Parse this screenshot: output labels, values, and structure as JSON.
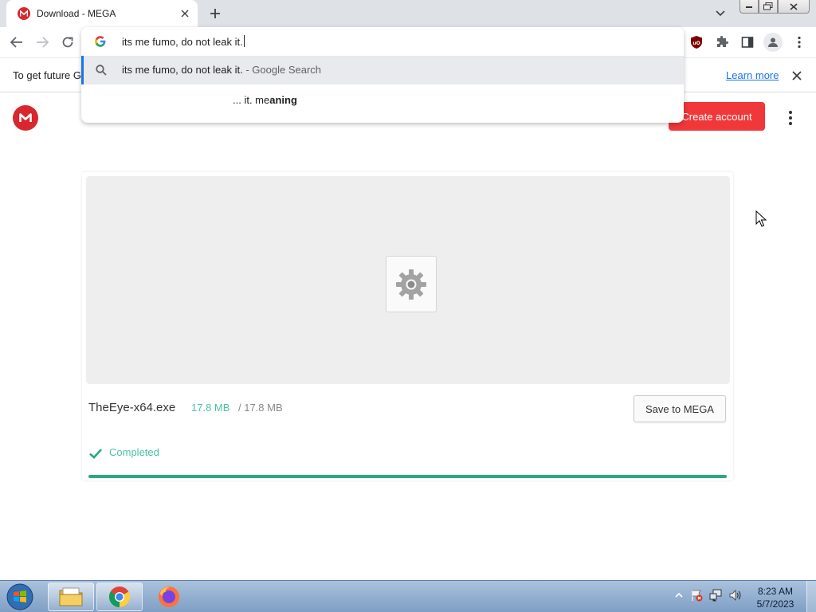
{
  "browser": {
    "tab": {
      "title": "Download - MEGA",
      "favicon": "mega-icon"
    },
    "omnibox": {
      "value": "its me fumo, do not leak it.",
      "suggestions": [
        {
          "query": "its me fumo, do not leak it.",
          "suffix": "- Google Search",
          "icon": "search-icon"
        },
        {
          "prefix": "... it. me",
          "bold": "aning"
        }
      ]
    },
    "infobar": {
      "text": "To get future G",
      "link": "Learn more"
    }
  },
  "mega": {
    "create_account": "Create account",
    "file": {
      "name": "TheEye-x64.exe",
      "downloaded": "17.8 MB",
      "total": "/ 17.8 MB",
      "progress": 1.0
    },
    "save_button": "Save to MEGA",
    "status": "Completed",
    "accent": "#4ac2a4",
    "brand": "#d9272e"
  },
  "taskbar": {
    "time": "8:23 AM",
    "date": "5/7/2023"
  }
}
